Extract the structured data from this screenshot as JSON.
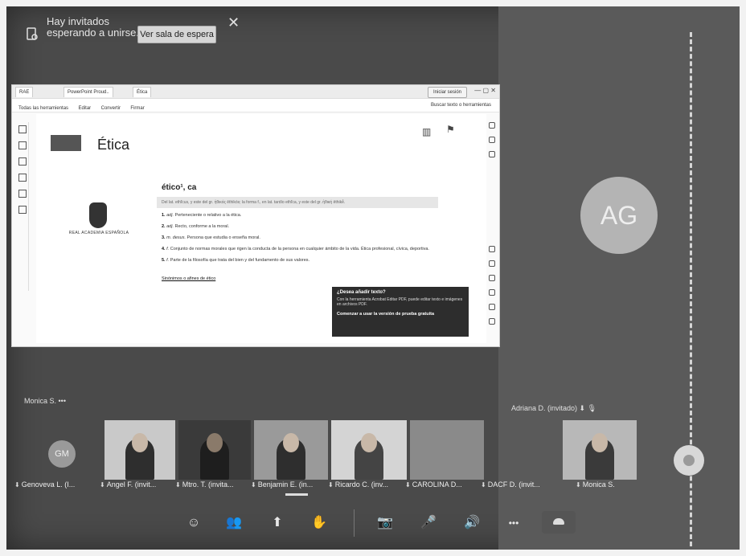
{
  "notification": {
    "message": "Hay invitados esperando a unirse.",
    "button_label": "Ver sala de espera",
    "close_glyph": "✕"
  },
  "shared_window": {
    "tabs": [
      "RAE",
      "PowerPoint Proud..",
      "Ética"
    ],
    "signin_label": "Iniciar sesión",
    "window_controls": "—  ▢  ✕",
    "menu": [
      "Todas las herramientas",
      "Editar",
      "Convertir",
      "Firmar"
    ],
    "search_label": "Buscar texto o herramientas",
    "doc_title": "Ética",
    "logo_text": "REAL ACADEMIA ESPAÑOLA",
    "entry_word": "ético¹, ca",
    "etymology": "Del lat. ethĭcus, y este del gr. ἠθικός ēthikós; la forma f., en lat. tardío ethĭca, y este del gr. ἠθική ēthikḗ.",
    "definitions": [
      {
        "num": "1.",
        "tag": "adj.",
        "text": "Perteneciente o relativo a la ética."
      },
      {
        "num": "2.",
        "tag": "adj.",
        "text": "Recto, conforme a la moral."
      },
      {
        "num": "3.",
        "tag": "m. desus.",
        "text": "Persona que estudia o enseña moral."
      },
      {
        "num": "4.",
        "tag": "f.",
        "text": "Conjunto de normas morales que rigen la conducta de la persona en cualquier ámbito de la vida. Ética profesional, cívica, deportiva."
      },
      {
        "num": "5.",
        "tag": "f.",
        "text": "Parte de la filosofía que trata del bien y del fundamento de sus valores."
      }
    ],
    "see_also": "Sinónimos o afines de ético",
    "popup": {
      "heading": "¿Desea añadir texto?",
      "body": "Con la herramienta Acrobat Editar PDF, puede editar texto e imágenes en archivos PDF.",
      "link": "Comenzar a usar la versión de prueba gratuita"
    }
  },
  "avatar_large": {
    "initials": "AG"
  },
  "speaker_left": "Monica S. •••",
  "speaker_right": "Adriana D. (invitado) ⬇ 🎙",
  "participants": [
    {
      "name": "Genoveva L. (I...",
      "initials": "GM"
    },
    {
      "name": "Angel F. (invit..."
    },
    {
      "name": "Mtro. T. (invita..."
    },
    {
      "name": "Benjamin E. (in..."
    },
    {
      "name": "Ricardo C. (inv..."
    },
    {
      "name": "CAROLINA D..."
    },
    {
      "name": "DACF D. (invit..."
    },
    {
      "name": "Monica S."
    }
  ],
  "toolbar": {
    "chat_icon": "☺",
    "people_icon": "👥",
    "share_icon": "⬆",
    "reactions_icon": "✋",
    "camera_icon": "📷",
    "mic_icon": "🎤",
    "speaker_icon": "🔊",
    "more_icon": "•••"
  }
}
